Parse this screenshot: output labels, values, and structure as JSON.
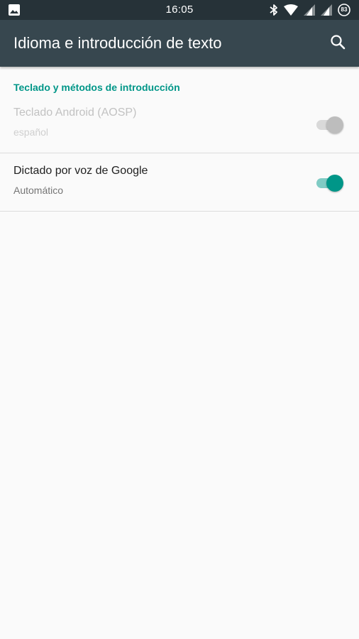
{
  "status_bar": {
    "time": "16:05",
    "battery_level": "83",
    "icons": [
      "image-icon",
      "bluetooth-icon",
      "wifi-icon",
      "signal-icon",
      "signal-icon",
      "battery-icon"
    ]
  },
  "app_bar": {
    "title": "Idioma e introducción de texto",
    "action_icon": "search-icon"
  },
  "section": {
    "header": "Teclado y métodos de introducción"
  },
  "preferences": [
    {
      "title": "Teclado Android (AOSP)",
      "summary": "español",
      "enabled": false,
      "checked": true
    },
    {
      "title": "Dictado por voz de Google",
      "summary": "Automático",
      "enabled": true,
      "checked": true
    }
  ],
  "colors": {
    "status_bar": "#263238",
    "app_bar": "#37474f",
    "accent": "#009688",
    "accent_track": "#80cbc4",
    "background": "#fafafa"
  }
}
